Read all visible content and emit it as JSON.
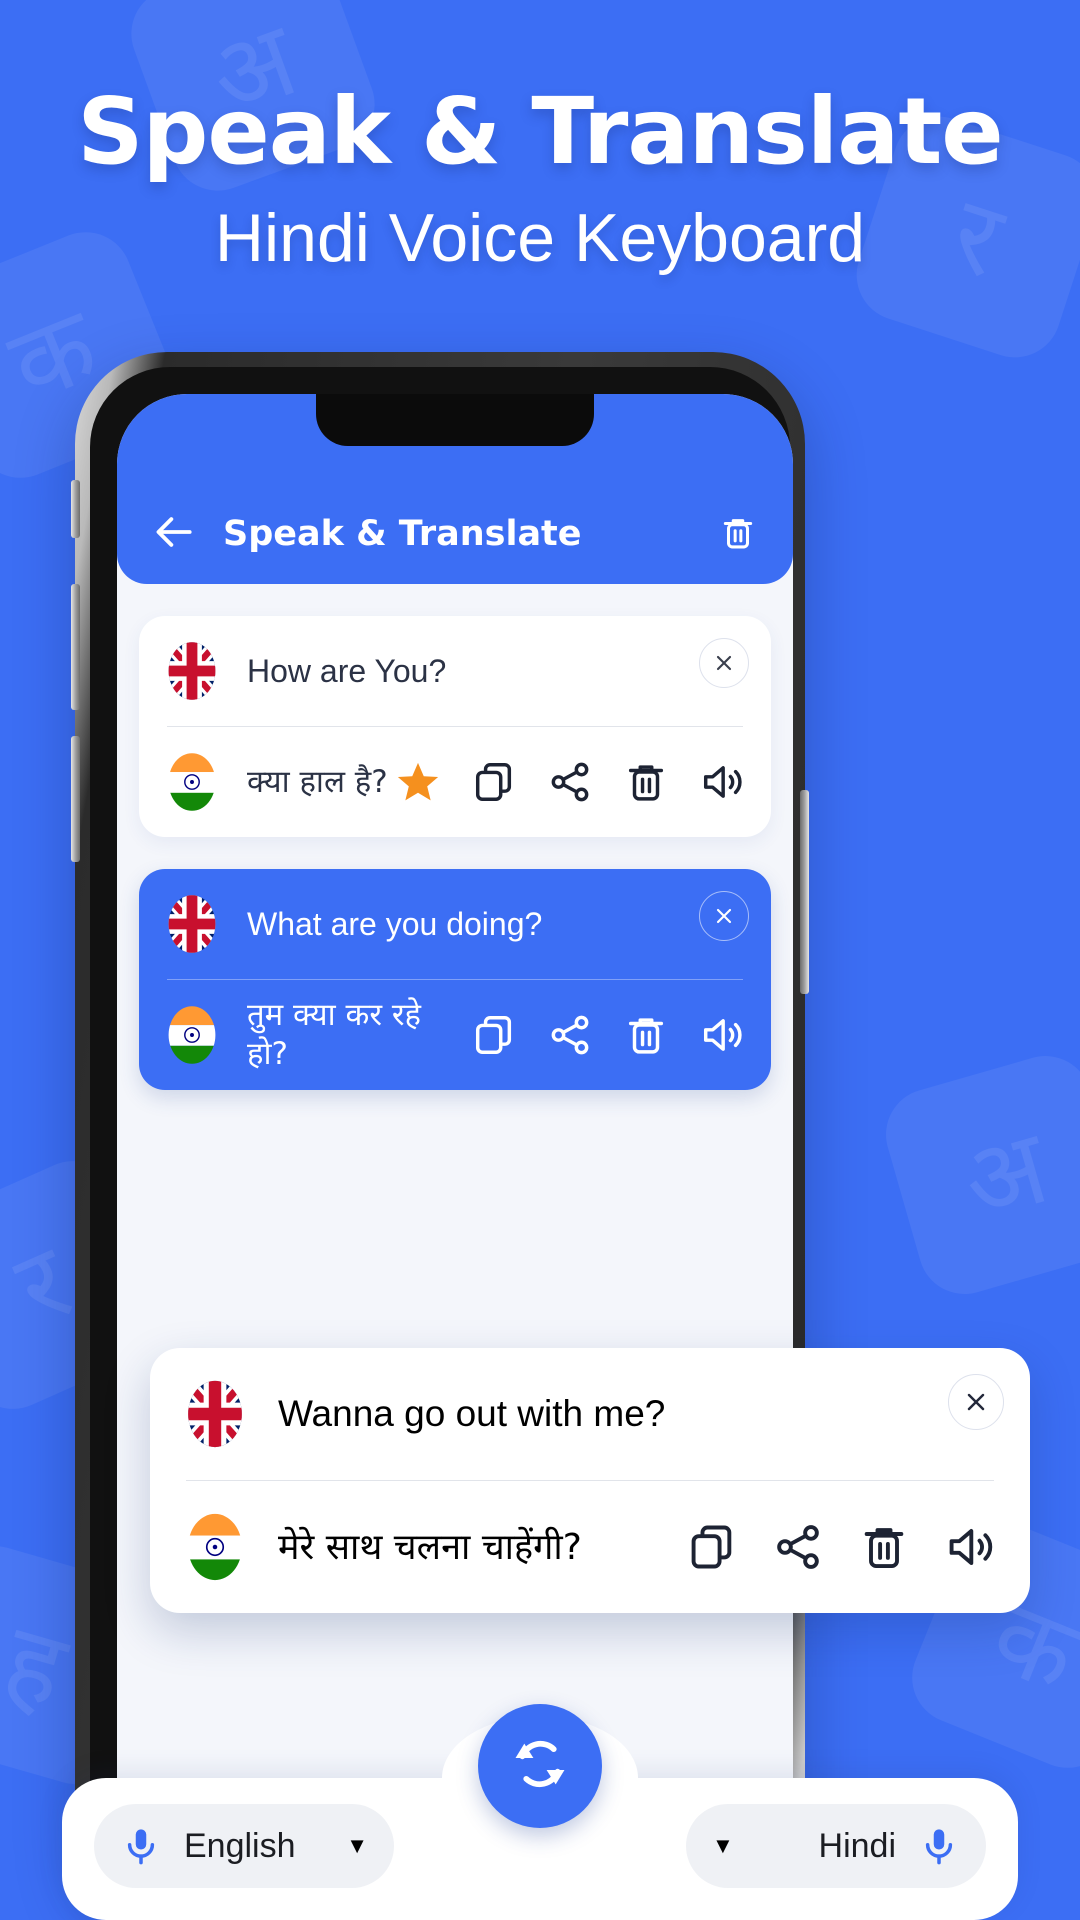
{
  "theme": {
    "brand_blue": "#3C6EF4",
    "screen_bg": "#F4F6FB",
    "card_white": "#FFFFFF",
    "star_orange": "#F5901E",
    "pill_grey": "#EFF1F5",
    "text_dark": "#2B3245"
  },
  "hero": {
    "title": "Speak & Translate",
    "subtitle": "Hindi Voice Keyboard"
  },
  "background_pattern": {
    "glyphs": [
      "अ",
      "क",
      "र",
      "ह"
    ]
  },
  "app": {
    "header": {
      "back_icon": "back-arrow-icon",
      "title": "Speak & Translate",
      "delete_icon": "trash-icon"
    },
    "cards": [
      {
        "style": "white",
        "source_flag": "uk-flag-icon",
        "source_text": "How are You?",
        "target_flag": "india-flag-icon",
        "target_text": "क्या हाल है?",
        "starred": true,
        "close_icon": "close-icon",
        "actions": [
          "star-icon",
          "copy-icon",
          "share-icon",
          "trash-icon",
          "speaker-icon"
        ]
      },
      {
        "style": "blue",
        "source_flag": "uk-flag-icon",
        "source_text": "What are you doing?",
        "target_flag": "india-flag-icon",
        "target_text": "तुम क्या कर रहे हो?",
        "starred": false,
        "close_icon": "close-icon",
        "actions": [
          "copy-icon",
          "share-icon",
          "trash-icon",
          "speaker-icon"
        ]
      },
      {
        "style": "floating-white",
        "source_flag": "uk-flag-icon",
        "source_text": "Wanna go out with me?",
        "target_flag": "india-flag-icon",
        "target_text": "मेरे साथ चलना चाहेंगी?",
        "starred": false,
        "close_icon": "close-icon",
        "actions": [
          "copy-icon",
          "share-icon",
          "trash-icon",
          "speaker-icon"
        ]
      }
    ],
    "bottom_bar": {
      "source_language": "English",
      "target_language": "Hindi",
      "source_mic_icon": "microphone-icon",
      "target_mic_icon": "microphone-icon",
      "source_caret": "▼",
      "target_caret": "▼",
      "swap_icon": "swap-languages-icon"
    }
  }
}
